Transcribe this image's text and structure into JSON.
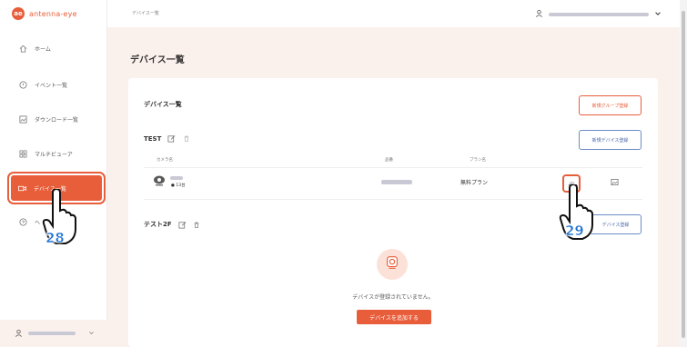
{
  "app": {
    "logo_mark": "ae",
    "logo_text": "antenna-eye"
  },
  "breadcrumb": "デバイス一覧",
  "sidebar": {
    "items": [
      {
        "label": "ホーム",
        "icon": "home-icon"
      },
      {
        "label": "イベント一覧",
        "icon": "event-icon"
      },
      {
        "label": "ダウンロード一覧",
        "icon": "download-icon"
      },
      {
        "label": "マルチビューア",
        "icon": "grid-icon"
      },
      {
        "label": "デバイス一覧",
        "icon": "camera-icon",
        "active": true
      },
      {
        "label": "ヘ",
        "icon": "help-icon"
      }
    ],
    "footer_icon": "user-icon"
  },
  "page": {
    "title": "デバイス一覧",
    "card_title": "デバイス一覧",
    "new_group_button": "新規グループ登録",
    "group1": {
      "name": "TEST",
      "new_device_button": "新規デバイス登録",
      "columns": [
        "カメラ名",
        "品番",
        "プラン名"
      ],
      "rows": [
        {
          "status": "● 13台",
          "plan": "無料プラン"
        }
      ]
    },
    "group2": {
      "name": "テスト2F",
      "new_device_button": "デバイス登録",
      "empty_message": "デバイスが登録されていません。",
      "add_device_button": "デバイスを追加する"
    }
  },
  "annotations": {
    "left": "28",
    "right": "29"
  },
  "colors": {
    "accent": "#e85d3a",
    "bg": "#fbf1ec",
    "badge": "#1a6fd1"
  }
}
